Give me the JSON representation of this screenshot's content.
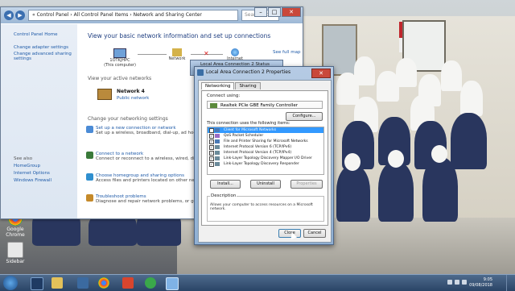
{
  "control_panel": {
    "address": "« Control Panel › All Control Panel Items › Network and Sharing Center",
    "search_placeholder": "Search Con...",
    "sidebar": {
      "home": "Control Panel Home",
      "links": [
        "Change adapter settings",
        "Change advanced sharing settings"
      ],
      "see_also_label": "See also",
      "see_also": [
        "HomeGroup",
        "Internet Options",
        "Windows Firewall"
      ]
    },
    "heading": "View your basic network information and set up connections",
    "see_full_map": "See full map",
    "map": {
      "computer": "1OTKJHPC",
      "computer_sub": "(This computer)",
      "network": "Network",
      "internet": "Internet"
    },
    "active_networks_label": "View your active networks",
    "active_network": {
      "name": "Network 4",
      "type": "Public network"
    },
    "change_settings_label": "Change your networking settings",
    "tasks": [
      {
        "link": "Set up a new connection or network",
        "desc": "Set up a wireless, broadband, dial-up, ad hoc..."
      },
      {
        "link": "Connect to a network",
        "desc": "Connect or reconnect to a wireless, wired, dial-..."
      },
      {
        "link": "Choose homegroup and sharing options",
        "desc": "Access files and printers located on other netw..."
      },
      {
        "link": "Troubleshoot problems",
        "desc": "Diagnose and repair network problems, or get t..."
      }
    ]
  },
  "status_dialog": {
    "title": "Local Area Connection 2 Status"
  },
  "properties_dialog": {
    "title": "Local Area Connection 2 Properties",
    "tabs": [
      "Networking",
      "Sharing"
    ],
    "connect_using_label": "Connect using:",
    "adapter": "Realtek PCIe GBE Family Controller",
    "configure_button": "Configure...",
    "items_label": "This connection uses the following items:",
    "items": [
      {
        "label": "Client for Microsoft Networks",
        "checked": true,
        "selected": true
      },
      {
        "label": "QoS Packet Scheduler",
        "checked": true,
        "selected": false
      },
      {
        "label": "File and Printer Sharing for Microsoft Networks",
        "checked": true,
        "selected": false
      },
      {
        "label": "Internet Protocol Version 6 (TCP/IPv6)",
        "checked": true,
        "selected": false
      },
      {
        "label": "Internet Protocol Version 4 (TCP/IPv4)",
        "checked": true,
        "selected": false
      },
      {
        "label": "Link-Layer Topology Discovery Mapper I/O Driver",
        "checked": true,
        "selected": false
      },
      {
        "label": "Link-Layer Topology Discovery Responder",
        "checked": true,
        "selected": false
      }
    ],
    "install_button": "Install...",
    "uninstall_button": "Uninstall",
    "properties_button": "Properties",
    "description_label": "Description",
    "description_text": "Allows your computer to access resources on a Microsoft network.",
    "close_button": "Close",
    "cancel_button": "Cancel"
  },
  "desktop": {
    "icons": [
      "Google Chrome",
      "Sidebar"
    ]
  },
  "taskbar": {
    "time": "9:05",
    "date": "09/08/2018"
  }
}
